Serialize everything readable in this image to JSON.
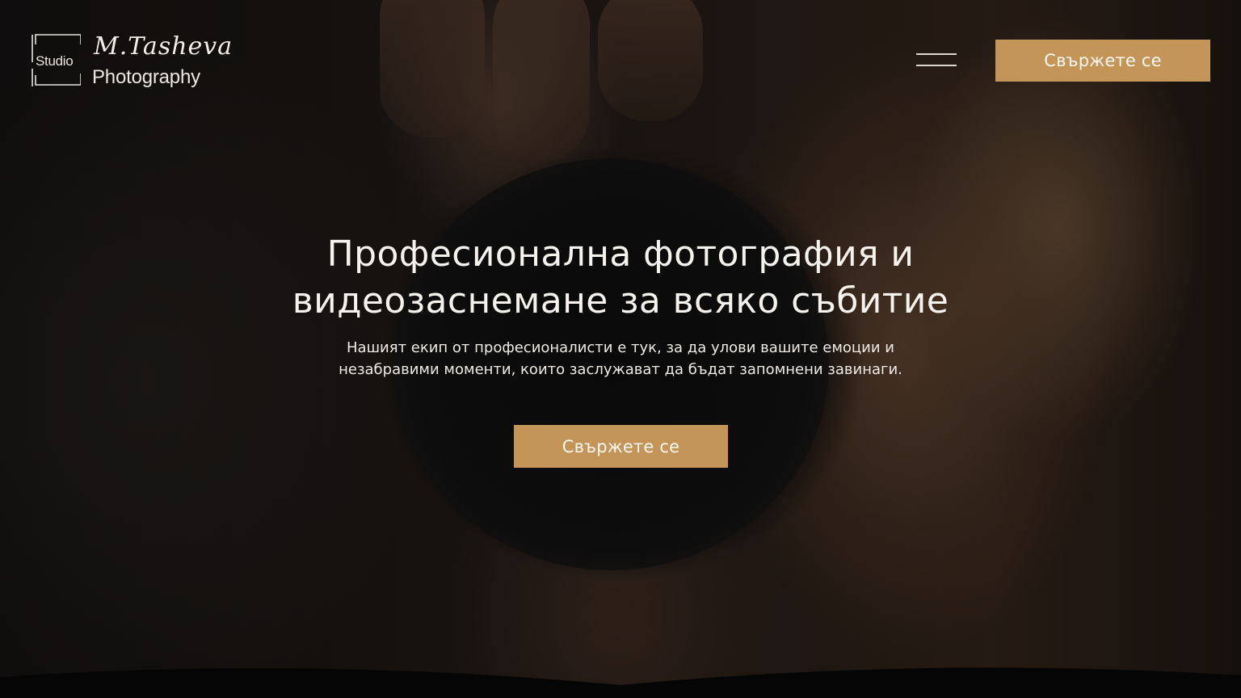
{
  "brand": {
    "studio": "Studio",
    "name": "M.Tasheva",
    "tagline": "Photography"
  },
  "header": {
    "menu_icon": "hamburger-menu-icon",
    "cta_label": "Свържете се"
  },
  "hero": {
    "title": "Професионална фотография и видеозаснемане за всяко събитие",
    "subtitle": "Нашият екип от професионалисти е тук, за да улови вашите емоции и незабравими моменти, които заслужават да бъдат запомнени завинаги.",
    "cta_label": "Свържете се"
  },
  "colors": {
    "accent": "#c49558",
    "text": "#f6f2ee",
    "background": "#0b0908"
  }
}
